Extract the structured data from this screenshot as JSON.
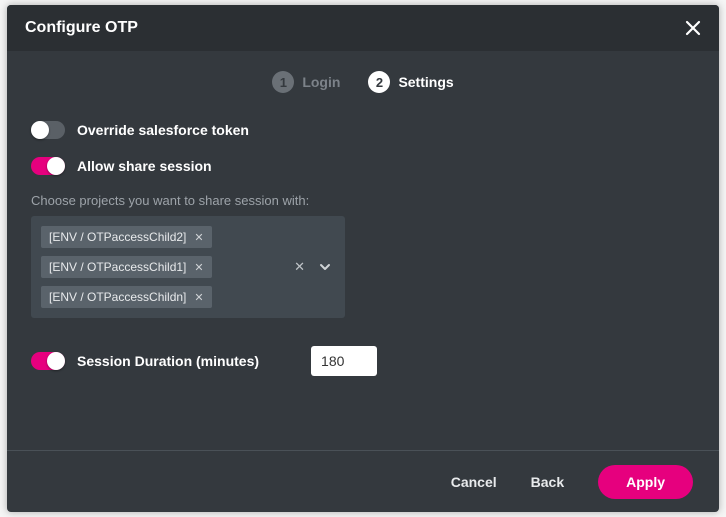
{
  "header": {
    "title": "Configure OTP"
  },
  "steps": [
    {
      "num": "1",
      "label": "Login",
      "state": "inactive"
    },
    {
      "num": "2",
      "label": "Settings",
      "state": "active"
    }
  ],
  "toggles": {
    "override_sf": {
      "label": "Override salesforce token",
      "on": false
    },
    "share_session": {
      "label": "Allow share session",
      "on": true
    },
    "session_duration": {
      "label": "Session Duration (minutes)",
      "on": true
    }
  },
  "projects_label": "Choose projects you want to share session with:",
  "projects": [
    "[ENV / OTPaccessChild2]",
    "[ENV / OTPaccessChild1]",
    "[ENV / OTPaccessChildn]"
  ],
  "session_duration_value": "180",
  "footer": {
    "cancel": "Cancel",
    "back": "Back",
    "apply": "Apply"
  },
  "colors": {
    "accent": "#e6007e",
    "panel": "#34393e"
  }
}
